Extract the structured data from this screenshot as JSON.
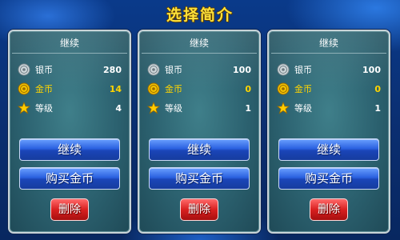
{
  "screen": {
    "title": "选择简介"
  },
  "labels": {
    "silver": "银币",
    "gold": "金币",
    "level": "等级"
  },
  "slots": [
    {
      "header": "继续",
      "silver": "280",
      "gold": "14",
      "level": "4",
      "continue_label": "继续",
      "buy_label": "购买金币",
      "delete_label": "删除"
    },
    {
      "header": "继续",
      "silver": "100",
      "gold": "0",
      "level": "1",
      "continue_label": "继续",
      "buy_label": "购买金币",
      "delete_label": "删除"
    },
    {
      "header": "继续",
      "silver": "100",
      "gold": "0",
      "level": "1",
      "continue_label": "继续",
      "buy_label": "购买金币",
      "delete_label": "删除"
    }
  ],
  "icons": {
    "silver": "silver-coin-icon",
    "gold": "gold-coin-icon",
    "level": "star-icon"
  },
  "colors": {
    "title": "#ffe23a",
    "gold_text": "#ffd400",
    "button_blue": "#2b61e0",
    "button_red": "#d92020"
  }
}
